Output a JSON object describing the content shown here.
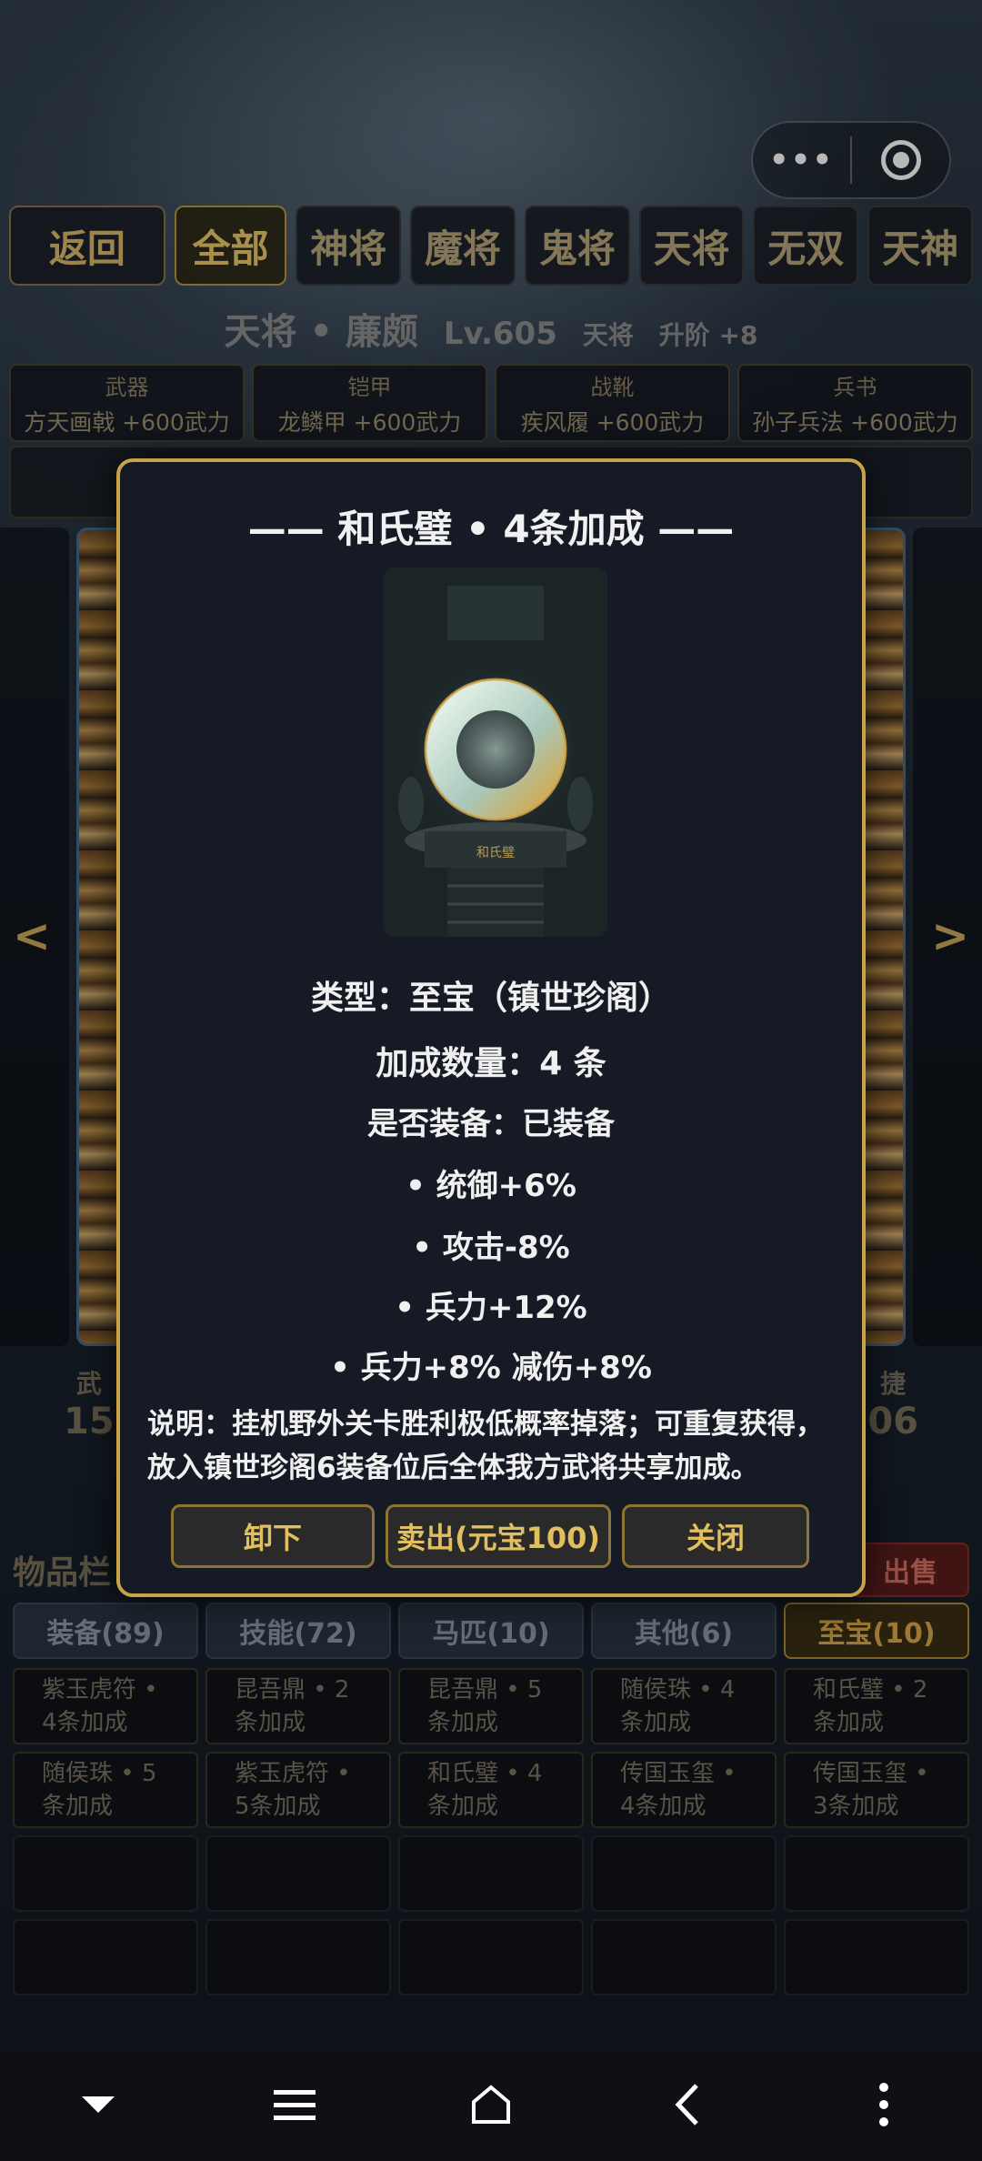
{
  "capsule": {
    "more_icon": "more-dots-icon",
    "close_icon": "target-icon"
  },
  "tabs": {
    "back": "返回",
    "items": [
      "全部",
      "神将",
      "魔将",
      "鬼将",
      "天将",
      "无双",
      "天神"
    ]
  },
  "hero": {
    "name": "天将 • 廉颇",
    "level": "Lv.605",
    "tag": "天将",
    "upgrade": "升阶 +8"
  },
  "equipment": [
    {
      "slot": "武器",
      "item": "方天画戟 +600武力"
    },
    {
      "slot": "铠甲",
      "item": "龙鳞甲 +600武力"
    },
    {
      "slot": "战靴",
      "item": "疾风履 +600武力"
    },
    {
      "slot": "兵书",
      "item": "孙子兵法 +600武力"
    }
  ],
  "nav_arrows": {
    "prev": "<",
    "next": ">"
  },
  "stats": {
    "left_label": "武",
    "left_value": "15",
    "right_label": "捷",
    "right_value": "06"
  },
  "items_panel": {
    "title": "物品栏",
    "sell": "出售",
    "categories": [
      "装备(89)",
      "技能(72)",
      "马匹(10)",
      "其他(6)",
      "至宝(10)"
    ],
    "active_category_index": 4,
    "cells": [
      "紫玉虎符 • 4条加成",
      "昆吾鼎 • 2条加成",
      "昆吾鼎 • 5条加成",
      "随侯珠 • 4条加成",
      "和氏璧 • 2条加成",
      "随侯珠 • 5条加成",
      "紫玉虎符 • 5条加成",
      "和氏璧 • 4条加成",
      "传国玉玺 • 4条加成",
      "传国玉玺 • 3条加成"
    ]
  },
  "modal": {
    "title": "—— 和氏璧 • 4条加成 ——",
    "type_line": "类型：至宝（镇世珍阁）",
    "count_line": "加成数量：4 条",
    "equipped_line": "是否装备：已装备",
    "bonuses": [
      "• 统御+6%",
      "• 攻击-8%",
      "• 兵力+12%",
      "• 兵力+8% 减伤+8%"
    ],
    "description": "说明：挂机野外关卡胜利极低概率掉落；可重复获得，放入镇世珍阁6装备位后全体我方武将共享加成。",
    "image_caption": "和氏璧",
    "buttons": {
      "unequip": "卸下",
      "sell": "卖出(元宝100)",
      "close": "关闭"
    }
  },
  "colors": {
    "gold_border": "#c9a24a",
    "modal_bg": "#161a24",
    "button_text": "#e2bf5e"
  },
  "system_nav": {
    "icons": [
      "chevron-down-icon",
      "menu-icon",
      "home-icon",
      "back-icon",
      "more-vertical-icon"
    ]
  }
}
